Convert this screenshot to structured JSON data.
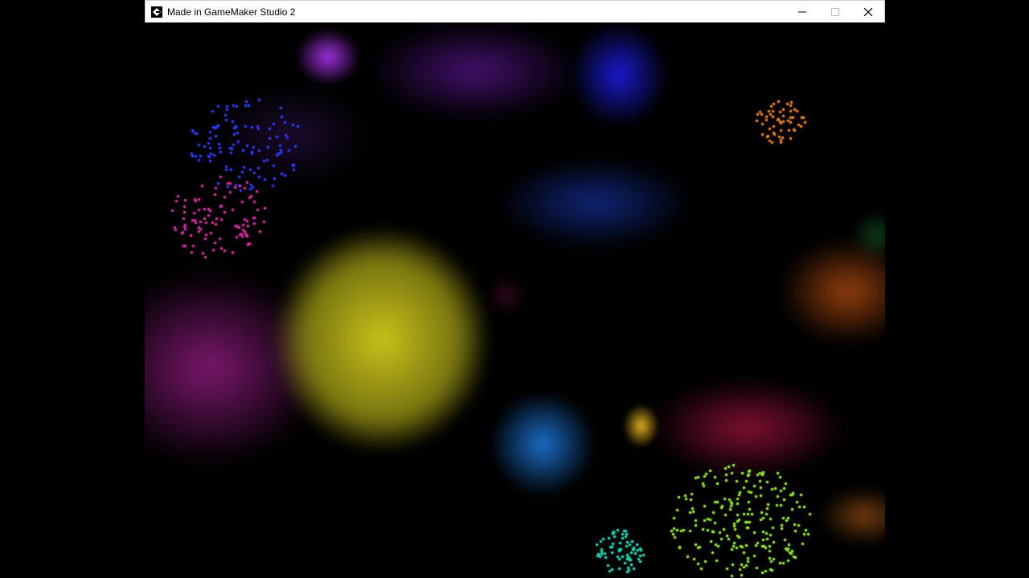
{
  "window": {
    "title": "Made in GameMaker Studio 2",
    "controls": {
      "minimize_icon": "minimize-icon",
      "maximize_icon": "maximize-icon",
      "close_icon": "close-icon"
    }
  },
  "colors": {
    "background": "#000000",
    "yellow": "#c8c21a",
    "magenta": "#8a1a7a",
    "crimson": "#8a1034",
    "blue_cloud": "#122a88",
    "light_blue": "#1a6ec8",
    "royal_blue": "#1a1ad0",
    "purple": "#4a1a8a",
    "violet": "#9a2ad8",
    "orange": "#b04a10",
    "lime": "#8ee02a",
    "teal": "#1ad0b0",
    "pink": "#d02aa0",
    "amber": "#e07a1a"
  }
}
